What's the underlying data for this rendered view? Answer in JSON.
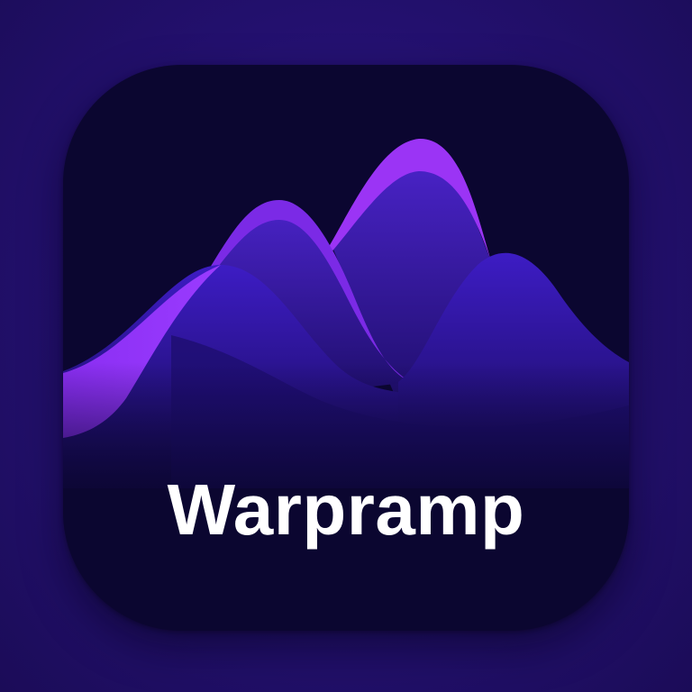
{
  "app": {
    "name": "Warpramp"
  },
  "colors": {
    "background": "#23106e",
    "tile": "#0b0630",
    "accent": "#8f2cf2",
    "accent_dark": "#3a19b6",
    "text": "#ffffff"
  },
  "icon": {
    "name": "waves-mountains-icon"
  }
}
